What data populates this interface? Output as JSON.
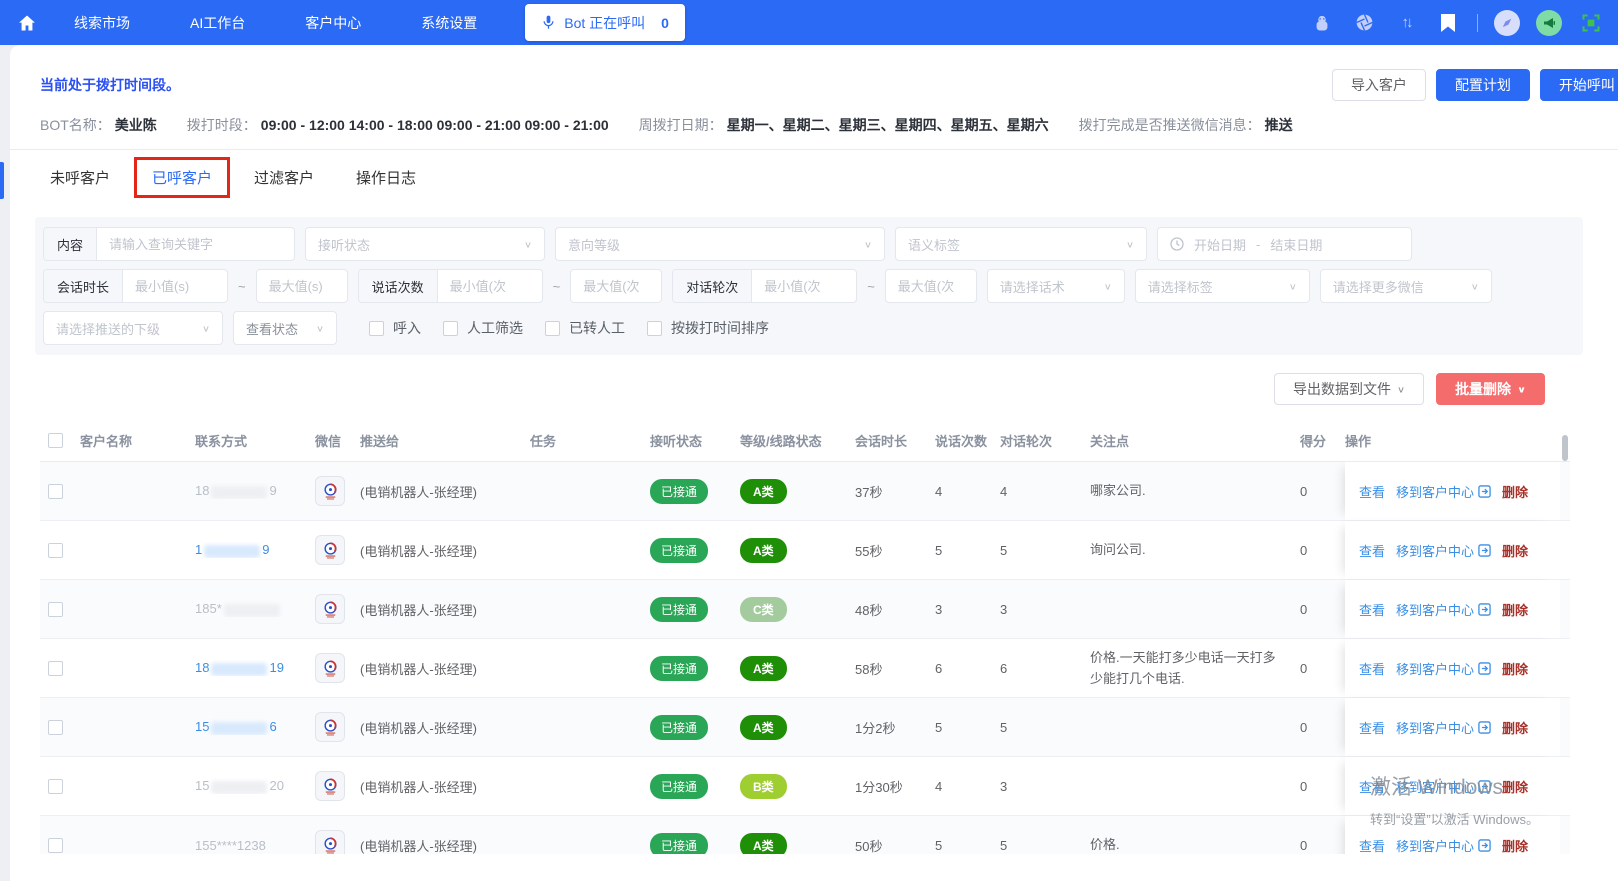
{
  "navbar": {
    "items": [
      "线索市场",
      "AI工作台",
      "客户中心",
      "系统设置"
    ],
    "bot_button": {
      "label": "Bot 正在呼叫",
      "count": "0"
    }
  },
  "header": {
    "status_text": "当前处于拨打时间段。",
    "buttons": {
      "import": "导入客户",
      "configure": "配置计划",
      "start_call": "开始呼叫"
    },
    "info": [
      {
        "label": "BOT名称：",
        "value": "美业陈"
      },
      {
        "label": "拨打时段：",
        "value": "09:00 - 12:00 14:00 - 18:00 09:00 - 21:00 09:00 - 21:00"
      },
      {
        "label": "周拨打日期：",
        "value": "星期一、星期二、星期三、星期四、星期五、星期六"
      },
      {
        "label": "拨打完成是否推送微信消息：",
        "value": "推送"
      }
    ]
  },
  "tabs": [
    {
      "label": "未呼客户",
      "active": false,
      "highlighted": false
    },
    {
      "label": "已呼客户",
      "active": true,
      "highlighted": true
    },
    {
      "label": "过滤客户",
      "active": false,
      "highlighted": false
    },
    {
      "label": "操作日志",
      "active": false,
      "highlighted": false
    }
  ],
  "filters": {
    "row1": {
      "content_label": "内容",
      "content_placeholder": "请输入查询关键字",
      "listen_status": "接听状态",
      "intent_level": "意向等级",
      "semantic_tag": "语义标签",
      "start_date": "开始日期",
      "date_sep": "-",
      "end_date": "结束日期"
    },
    "row2": {
      "duration_label": "会话时长",
      "duration_min": "最小值(s)",
      "duration_max": "最大值(s)",
      "talk_label": "说话次数",
      "talk_min": "最小值(次",
      "talk_max": "最大值(次",
      "round_label": "对话轮次",
      "round_min": "最小值(次",
      "round_max": "最大值(次",
      "tilde": "~",
      "script_select": "请选择话术",
      "tag_select": "请选择标签",
      "wechat_select": "请选择更多微信"
    },
    "row3": {
      "push_select": "请选择推送的下级",
      "view_status": "查看状态",
      "checkboxes": [
        "呼入",
        "人工筛选",
        "已转人工",
        "按拨打时间排序"
      ]
    }
  },
  "toolbar": {
    "export": "导出数据到文件",
    "batch_delete": "批量删除"
  },
  "table": {
    "columns": [
      "客户名称",
      "联系方式",
      "微信",
      "推送给",
      "任务",
      "接听状态",
      "等级/线路状态",
      "会话时长",
      "说话次数",
      "对话轮次",
      "关注点",
      "得分",
      "操作"
    ],
    "actions": {
      "view": "查看",
      "move": "移到客户中心",
      "delete": "删除"
    },
    "rows": [
      {
        "name": "",
        "phone": {
          "before": "18",
          "after": "9",
          "masked": true,
          "style": "gray"
        },
        "push_to": "(电销机器人-张经理)",
        "task": "",
        "listen_status": "已接通",
        "level": "A类",
        "lv": "A",
        "duration": "37秒",
        "talk": "4",
        "rounds": "4",
        "focus": "哪家公司.",
        "score": "0"
      },
      {
        "name": "",
        "phone": {
          "before": "1",
          "after": "9",
          "masked": true,
          "style": "blue"
        },
        "push_to": "(电销机器人-张经理)",
        "task": "",
        "listen_status": "已接通",
        "level": "A类",
        "lv": "A",
        "duration": "55秒",
        "talk": "5",
        "rounds": "5",
        "focus": "询问公司.",
        "score": "0"
      },
      {
        "name": "",
        "phone": {
          "before": "185*",
          "after": "",
          "masked": true,
          "style": "gray"
        },
        "push_to": "(电销机器人-张经理)",
        "task": "",
        "listen_status": "已接通",
        "level": "C类",
        "lv": "C",
        "duration": "48秒",
        "talk": "3",
        "rounds": "3",
        "focus": "",
        "score": "0"
      },
      {
        "name": "",
        "phone": {
          "before": "18",
          "after": "19",
          "masked": true,
          "style": "blue"
        },
        "push_to": "(电销机器人-张经理)",
        "task": "",
        "listen_status": "已接通",
        "level": "A类",
        "lv": "A",
        "duration": "58秒",
        "talk": "6",
        "rounds": "6",
        "focus": "价格.一天能打多少电话一天打多少能打几个电话.",
        "score": "0"
      },
      {
        "name": "",
        "phone": {
          "before": "15",
          "after": "6",
          "masked": true,
          "style": "blue"
        },
        "push_to": "(电销机器人-张经理)",
        "task": "",
        "listen_status": "已接通",
        "level": "A类",
        "lv": "A",
        "duration": "1分2秒",
        "talk": "5",
        "rounds": "5",
        "focus": "",
        "score": "0"
      },
      {
        "name": "",
        "phone": {
          "before": "15",
          "after": "20",
          "masked": true,
          "style": "gray"
        },
        "push_to": "(电销机器人-张经理)",
        "task": "",
        "listen_status": "已接通",
        "level": "B类",
        "lv": "B",
        "duration": "1分30秒",
        "talk": "4",
        "rounds": "3",
        "focus": "",
        "score": "0"
      },
      {
        "name": "",
        "phone": {
          "before": "155****1238",
          "after": "",
          "masked": false,
          "style": "gray"
        },
        "push_to": "(电销机器人-张经理)",
        "task": "",
        "listen_status": "已接通",
        "level": "A类",
        "lv": "A",
        "duration": "50秒",
        "talk": "5",
        "rounds": "5",
        "focus": "价格.",
        "score": "0"
      }
    ]
  },
  "watermark": {
    "line1": "激活 Windows",
    "line2": "转到“设置”以激活 Windows。"
  },
  "colors": {
    "navbar": "#2b6af5",
    "primary": "#2b6af5",
    "link": "#3a8ee6",
    "danger": "#f56c6c",
    "delete_text": "#a8322a",
    "answered": "#2aa657",
    "level_a": "#1f8f08",
    "level_b": "#9fce30",
    "level_c": "#a3cb9e",
    "annotation": "#e42618"
  }
}
